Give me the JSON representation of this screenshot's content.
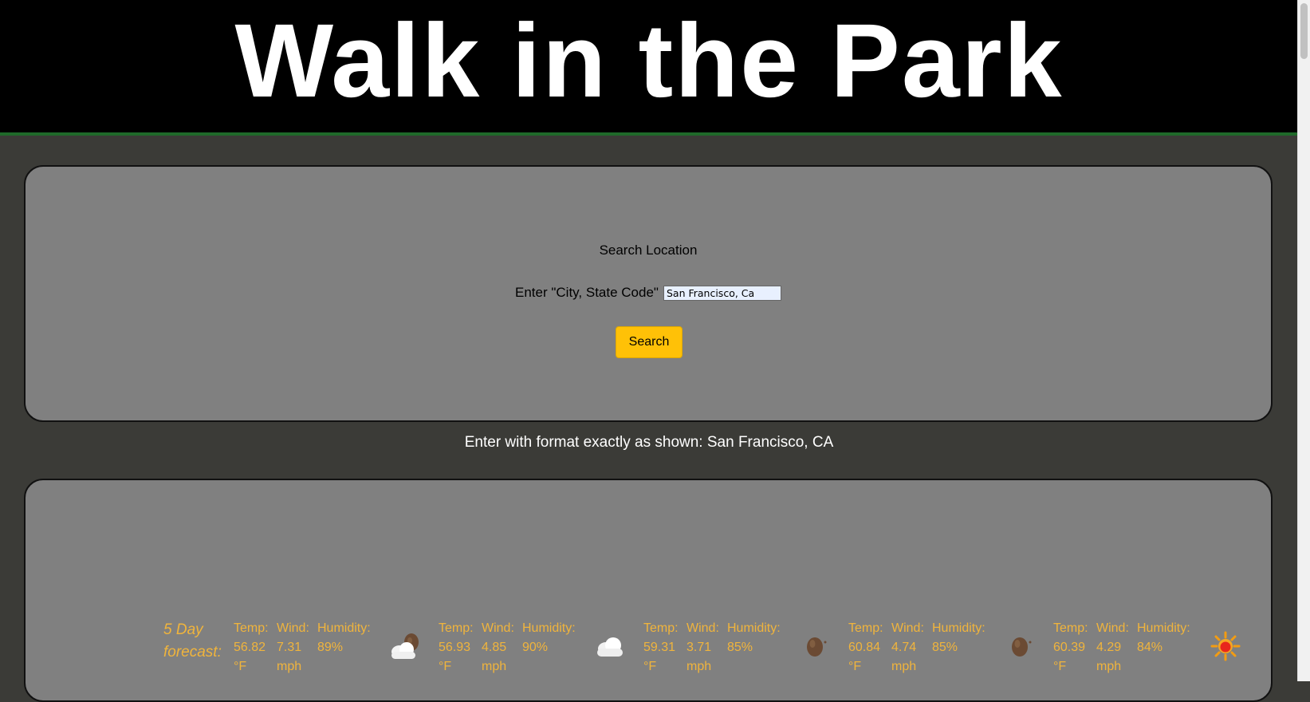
{
  "header": {
    "title": "Walk in the Park"
  },
  "search": {
    "title": "Search Location",
    "input_label": "Enter \"City, State Code\"",
    "input_value": "San Francisco, Ca",
    "button_label": "Search"
  },
  "hint": "Enter with format exactly as shown: San Francisco, CA",
  "forecast": {
    "label": "5 Day forecast:",
    "temp_key": "Temp:",
    "wind_key": "Wind:",
    "humidity_key": "Humidity:",
    "days": [
      {
        "temp": "56.82\n°F",
        "wind": "7.31\nmph",
        "humidity": "89%",
        "icon": "partly-cloudy-icon"
      },
      {
        "temp": "56.93\n°F",
        "wind": "4.85\nmph",
        "humidity": "90%",
        "icon": "cloud-icon"
      },
      {
        "temp": "59.31\n°F",
        "wind": "3.71\nmph",
        "humidity": "85%",
        "icon": "brown-orb-icon"
      },
      {
        "temp": "60.84\n°F",
        "wind": "4.74\nmph",
        "humidity": "85%",
        "icon": "brown-orb-icon"
      },
      {
        "temp": "60.39\n°F",
        "wind": "4.29\nmph",
        "humidity": "84%",
        "icon": "sun-icon"
      }
    ]
  },
  "colors": {
    "page_bg": "#3b3b37",
    "panel_bg": "#808080",
    "accent": "#ffc107",
    "forecast_text": "#f0b43c"
  }
}
